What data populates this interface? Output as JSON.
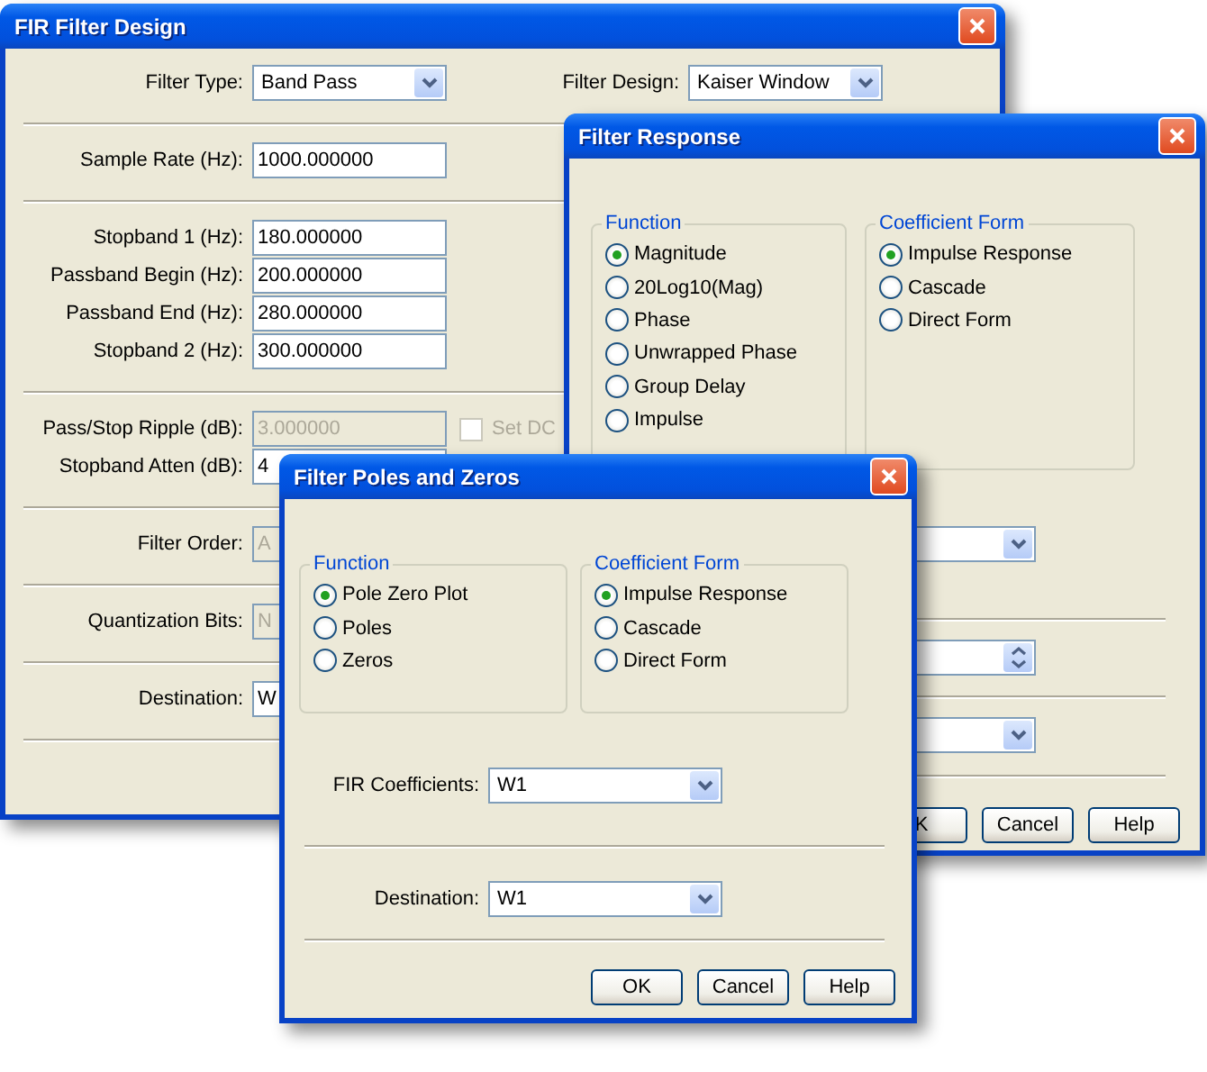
{
  "fir_design": {
    "title": "FIR Filter Design",
    "header": [
      {
        "label": "Filter Type:",
        "value": "Band Pass"
      },
      {
        "label": "Filter Design:",
        "value": "Kaiser Window"
      }
    ],
    "sections": [
      [
        {
          "label": "Sample Rate (Hz):",
          "value": "1000.000000",
          "disabled": false
        }
      ],
      [
        {
          "label": "Stopband 1 (Hz):",
          "value": "180.000000",
          "disabled": false
        },
        {
          "label": "Passband Begin (Hz):",
          "value": "200.000000",
          "disabled": false
        },
        {
          "label": "Passband End (Hz):",
          "value": "280.000000",
          "disabled": false
        },
        {
          "label": "Stopband 2 (Hz):",
          "value": "300.000000",
          "disabled": false
        }
      ],
      [
        {
          "label": "Pass/Stop Ripple (dB):",
          "value": "3.000000",
          "disabled": true,
          "checkbox": {
            "label": "Set DC",
            "checked": false,
            "disabled": true
          }
        },
        {
          "label": "Stopband Atten (dB):",
          "value": "4",
          "disabled": false
        }
      ],
      [
        {
          "label": "Filter Order:",
          "value": "A",
          "disabled": true
        }
      ],
      [
        {
          "label": "Quantization Bits:",
          "value": "N",
          "disabled": true
        }
      ],
      [
        {
          "label": "Destination:",
          "value": "W",
          "disabled": false
        }
      ]
    ]
  },
  "filter_response": {
    "title": "Filter Response",
    "groups": [
      {
        "legend": "Function",
        "options": [
          {
            "label": "Magnitude",
            "selected": true
          },
          {
            "label": "20Log10(Mag)",
            "selected": false
          },
          {
            "label": "Phase",
            "selected": false
          },
          {
            "label": "Unwrapped Phase",
            "selected": false
          },
          {
            "label": "Group Delay",
            "selected": false
          },
          {
            "label": "Impulse",
            "selected": false
          }
        ]
      },
      {
        "legend": "Coefficient Form",
        "options": [
          {
            "label": "Impulse Response",
            "selected": true
          },
          {
            "label": "Cascade",
            "selected": false
          },
          {
            "label": "Direct Form",
            "selected": false
          }
        ]
      }
    ],
    "controls": [
      {
        "kind": "combo"
      },
      {
        "kind": "spinner"
      },
      {
        "kind": "combo"
      }
    ],
    "buttons": [
      "K",
      "Cancel",
      "Help"
    ]
  },
  "poles_zeros": {
    "title": "Filter Poles and Zeros",
    "groups": [
      {
        "legend": "Function",
        "options": [
          {
            "label": "Pole Zero Plot",
            "selected": true
          },
          {
            "label": "Poles",
            "selected": false
          },
          {
            "label": "Zeros",
            "selected": false
          }
        ]
      },
      {
        "legend": "Coefficient Form",
        "options": [
          {
            "label": "Impulse Response",
            "selected": true
          },
          {
            "label": "Cascade",
            "selected": false
          },
          {
            "label": "Direct Form",
            "selected": false
          }
        ]
      }
    ],
    "fields": [
      {
        "label": "FIR Coefficients:",
        "value": "W1"
      },
      {
        "label": "Destination:",
        "value": "W1"
      }
    ],
    "buttons": [
      "OK",
      "Cancel",
      "Help"
    ]
  }
}
